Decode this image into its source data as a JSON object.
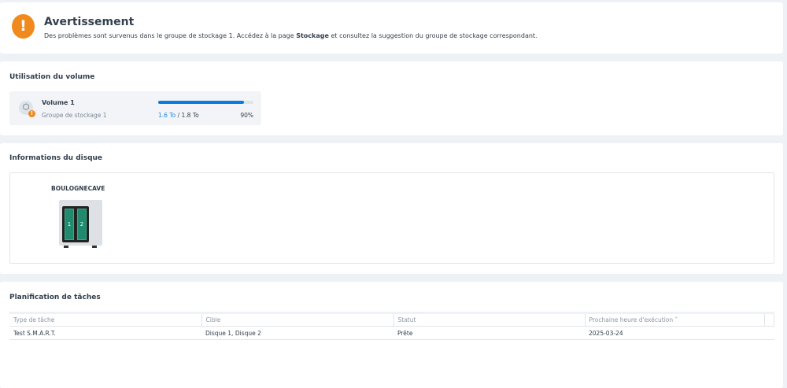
{
  "warning": {
    "title": "Avertissement",
    "msg_before": "Des problèmes sont survenus dans le groupe de stockage 1. Accédez à la page ",
    "msg_bold": "Stockage",
    "msg_after": " et consultez la suggestion du groupe de stockage correspondant."
  },
  "volume_usage": {
    "title": "Utilisation du volume",
    "name": "Volume 1",
    "group": "Groupe de stockage 1",
    "used": "1.6 To",
    "total": "1.8 To",
    "sep": " / ",
    "percent_label": "90%",
    "percent": 90
  },
  "disk_info": {
    "title": "Informations du disque",
    "hostname": "BOULOGNECAVE",
    "bays": [
      "1",
      "2"
    ]
  },
  "tasks": {
    "title": "Planification de tâches",
    "columns": [
      "Type de tâche",
      "Cible",
      "Statut",
      "Prochaine heure d'exécution ˄"
    ],
    "rows": [
      [
        "Test S.M.A.R.T.",
        "Disque 1, Disque 2",
        "Prête",
        "2025-03-24"
      ]
    ]
  }
}
